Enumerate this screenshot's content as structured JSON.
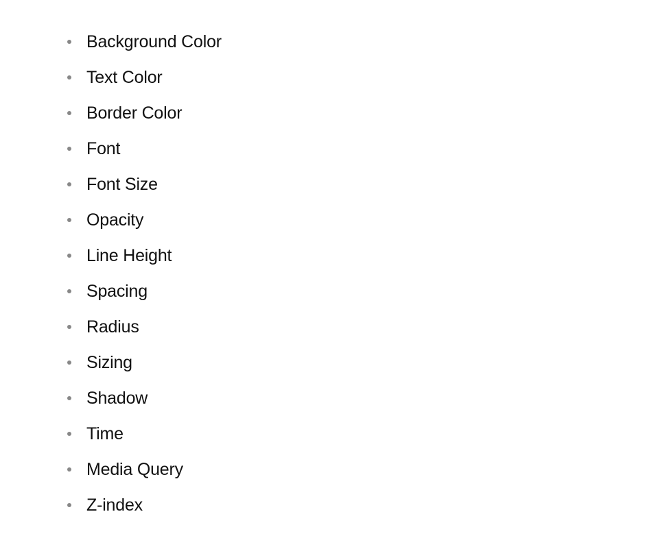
{
  "list": {
    "items": [
      {
        "label": "Background Color"
      },
      {
        "label": "Text Color"
      },
      {
        "label": "Border Color"
      },
      {
        "label": "Font"
      },
      {
        "label": "Font Size"
      },
      {
        "label": "Opacity"
      },
      {
        "label": "Line Height"
      },
      {
        "label": "Spacing"
      },
      {
        "label": "Radius"
      },
      {
        "label": "Sizing"
      },
      {
        "label": "Shadow"
      },
      {
        "label": "Time"
      },
      {
        "label": "Media Query"
      },
      {
        "label": "Z-index"
      }
    ]
  }
}
